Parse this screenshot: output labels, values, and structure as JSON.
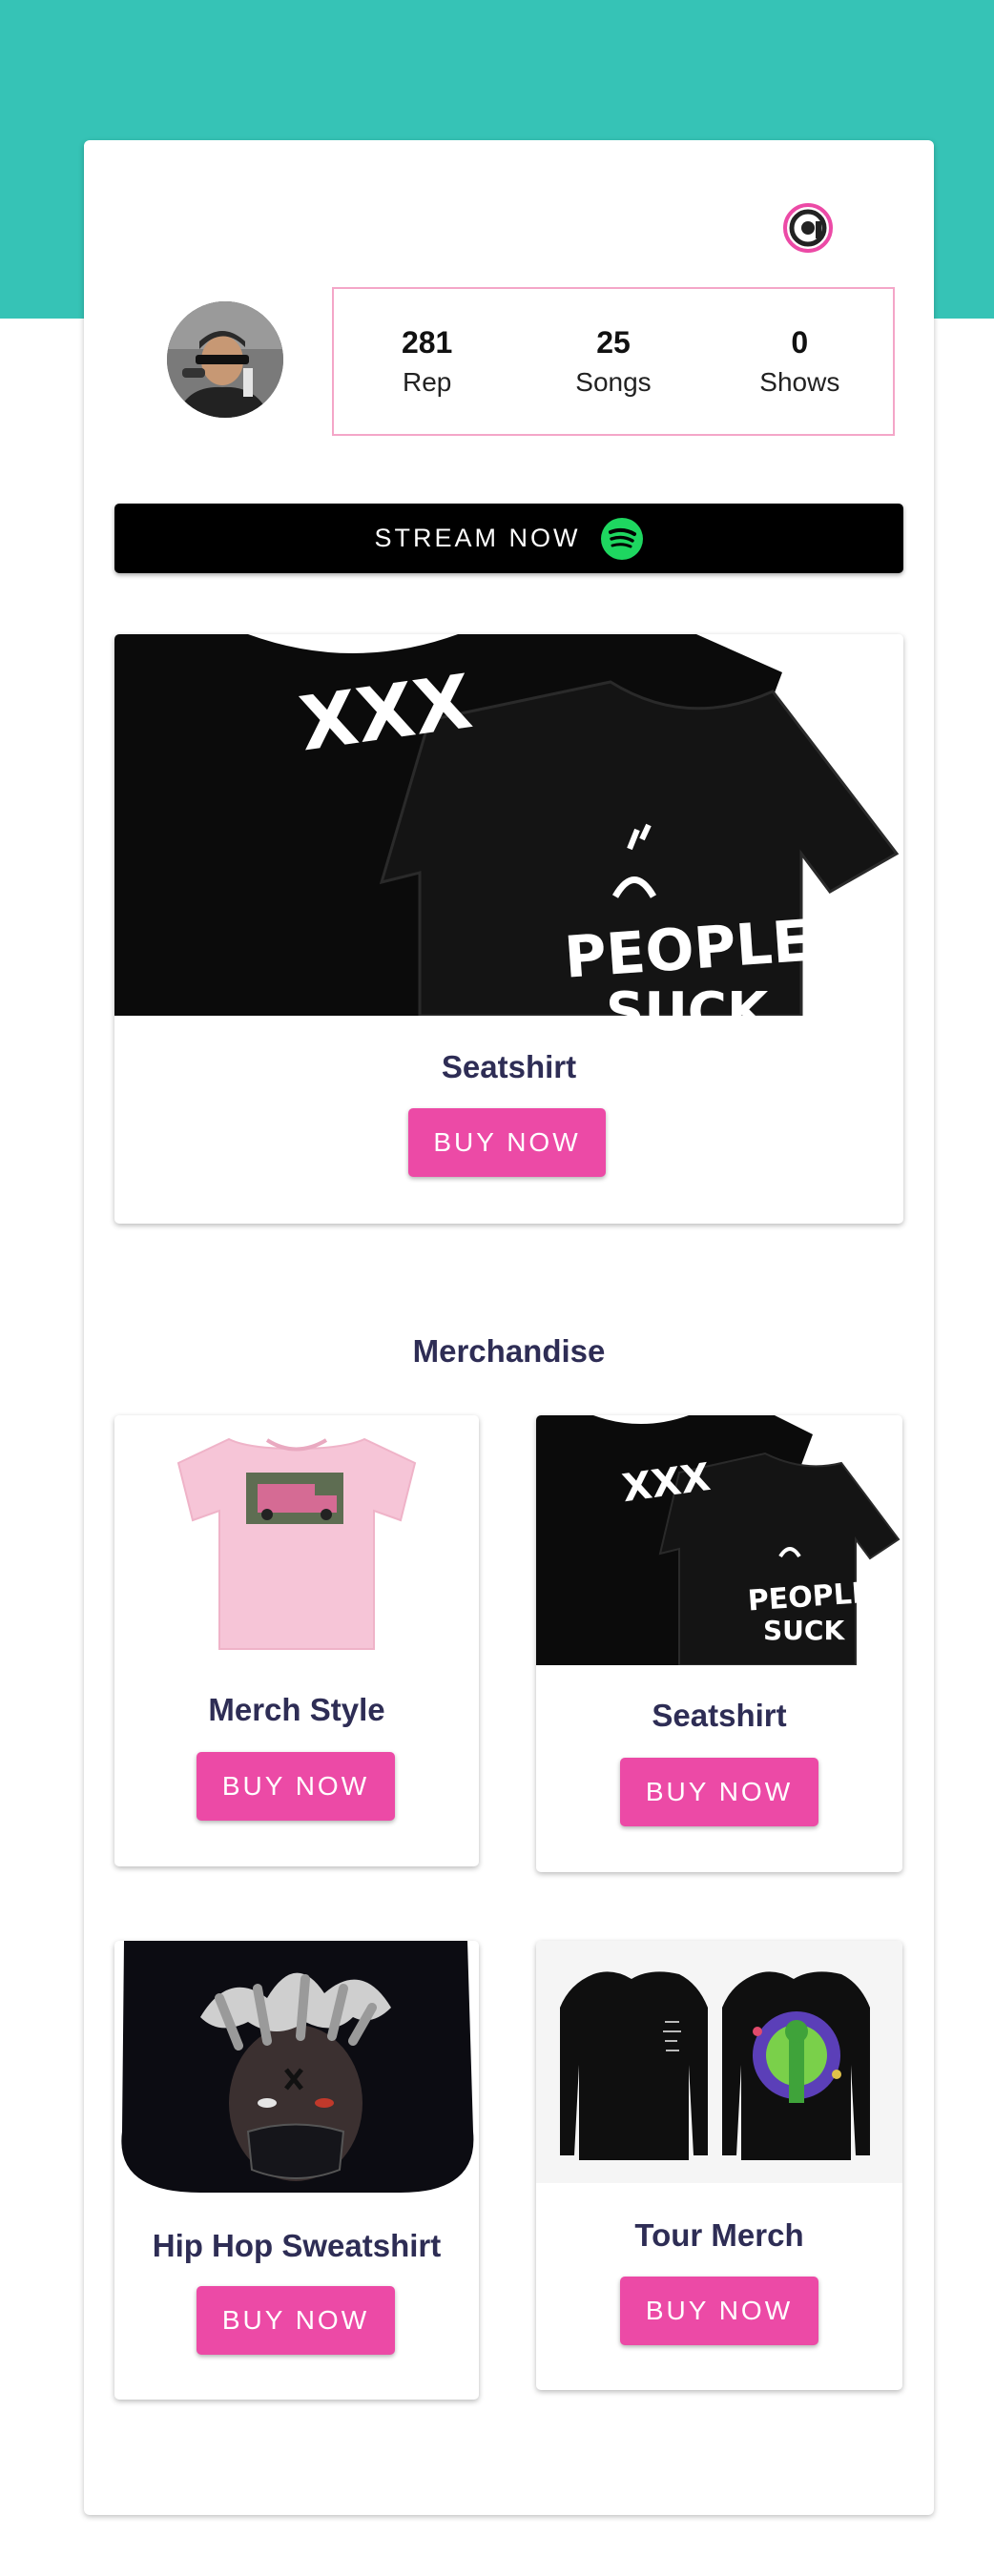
{
  "stats": [
    {
      "value": "281",
      "label": "Rep"
    },
    {
      "value": "25",
      "label": "Songs"
    },
    {
      "value": "0",
      "label": "Shows"
    }
  ],
  "stream": {
    "label": "STREAM NOW",
    "icon": "spotify-icon"
  },
  "featured": {
    "name": "Seatshirt",
    "button": "BUY NOW"
  },
  "merch": {
    "title": "Merchandise",
    "items": [
      {
        "name": "Merch Style",
        "button": "BUY NOW"
      },
      {
        "name": "Seatshirt",
        "button": "BUY NOW"
      },
      {
        "name": "Hip Hop Sweatshirt",
        "button": "BUY NOW"
      },
      {
        "name": "Tour Merch",
        "button": "BUY NOW"
      }
    ]
  },
  "product_art": {
    "xxx": "XXX",
    "people": "PEOPLE",
    "suck": "SUCK"
  },
  "colors": {
    "teal": "#36c3b6",
    "pink": "#ec4aa6",
    "navy": "#2e2d55",
    "spotify": "#1ed760"
  }
}
